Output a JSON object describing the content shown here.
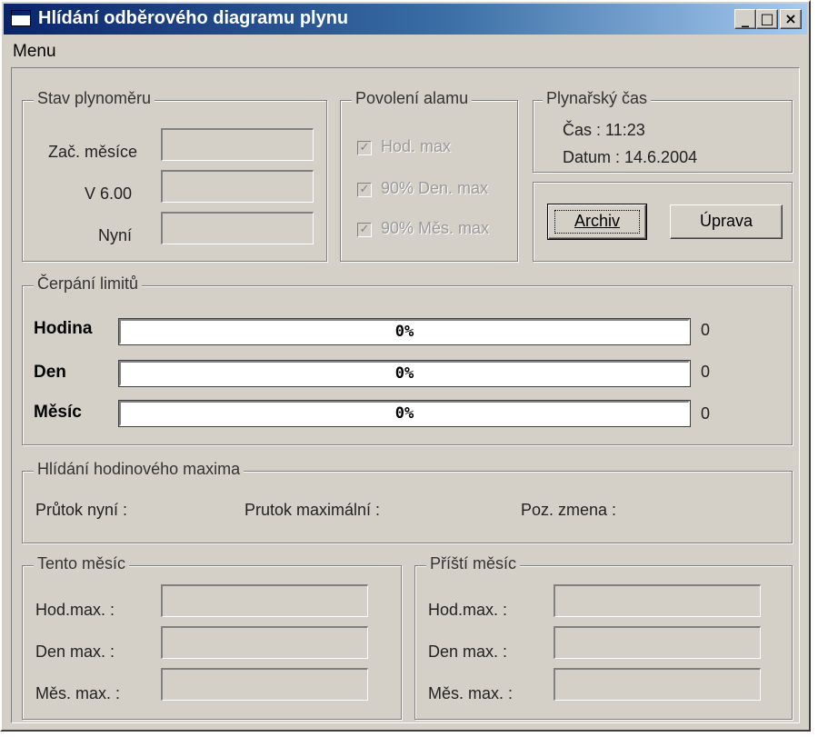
{
  "window": {
    "title": "Hlídání odběrového diagramu plynu"
  },
  "titlebar_buttons": {
    "minimize": "_",
    "maximize": "□",
    "close": "×"
  },
  "menu": {
    "items": [
      "Menu"
    ]
  },
  "stav": {
    "title": "Stav plynoměru",
    "rows": [
      {
        "label": "Zač. měsíce",
        "value": ""
      },
      {
        "label": "V 6.00",
        "value": ""
      },
      {
        "label": "Nyní",
        "value": ""
      }
    ]
  },
  "alarm": {
    "title": "Povolení alamu",
    "items": [
      {
        "label": "Hod. max",
        "checked": true
      },
      {
        "label": "90% Den. max",
        "checked": true
      },
      {
        "label": "90% Měs. max",
        "checked": true
      }
    ]
  },
  "cas": {
    "title": "Plynařský čas",
    "time_text": "Čas : 11:23",
    "date_text": "Datum : 14.6.2004"
  },
  "buttons": {
    "archiv": "Archiv",
    "uprava": "Úprava"
  },
  "limity": {
    "title": "Čerpání limitů",
    "rows": [
      {
        "label": "Hodina",
        "percent": 0,
        "percent_text": "0%",
        "value": "0"
      },
      {
        "label": "Den",
        "percent": 0,
        "percent_text": "0%",
        "value": "0"
      },
      {
        "label": "Měsíc",
        "percent": 0,
        "percent_text": "0%",
        "value": "0"
      }
    ]
  },
  "hodmax": {
    "title": "Hlídání hodinového maxima",
    "prutok_nyni": "Průtok nyní :",
    "prutok_max": "Prutok maximální :",
    "poz_zmena": "Poz. zmena :"
  },
  "tento": {
    "title": "Tento měsíc",
    "rows": [
      {
        "label": "Hod.max. :",
        "value": ""
      },
      {
        "label": "Den max. :",
        "value": ""
      },
      {
        "label": "Měs. max. :",
        "value": ""
      }
    ]
  },
  "pristi": {
    "title": "Příští měsíc",
    "rows": [
      {
        "label": "Hod.max. :",
        "value": ""
      },
      {
        "label": "Den max. :",
        "value": ""
      },
      {
        "label": "Měs. max. :",
        "value": ""
      }
    ]
  },
  "colors": {
    "titlebar_start": "#0a246a",
    "titlebar_end": "#a6caf0",
    "face": "#d4d0c8"
  }
}
